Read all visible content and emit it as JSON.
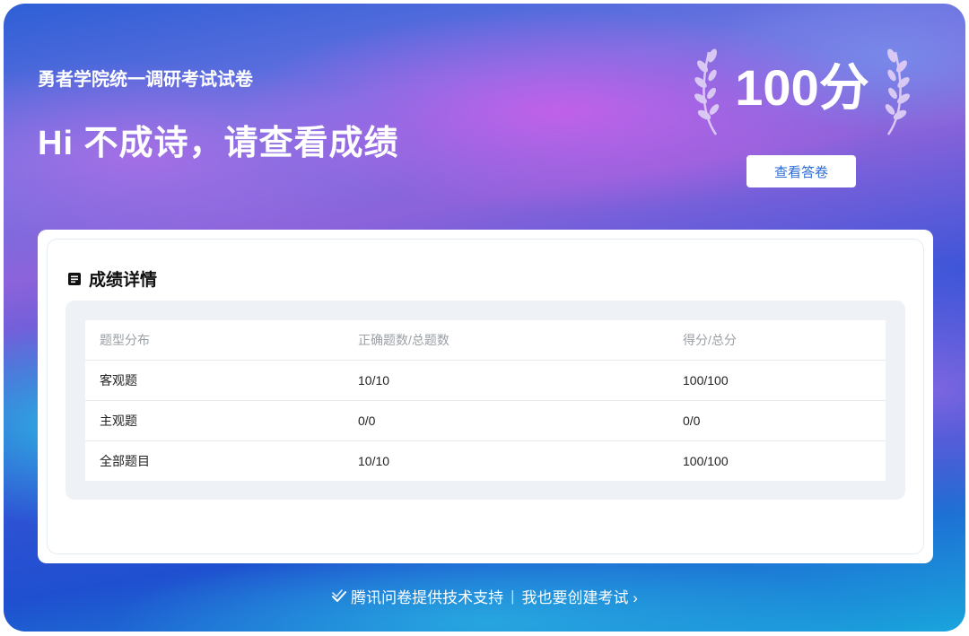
{
  "header": {
    "exam_title": "勇者学院统一调研考试试卷",
    "greeting": "Hi 不成诗，请查看成绩",
    "score": "100分",
    "view_answers_label": "查看答卷"
  },
  "details": {
    "title": "成绩详情",
    "icon": "document-list-icon",
    "columns": [
      "题型分布",
      "正确题数/总题数",
      "得分/总分"
    ],
    "rows": [
      [
        "客观题",
        "10/10",
        "100/100"
      ],
      [
        "主观题",
        "0/0",
        "0/0"
      ],
      [
        "全部题目",
        "10/10",
        "100/100"
      ]
    ]
  },
  "footer": {
    "support_text": "腾讯问卷提供技术支持",
    "divider": "|",
    "create_link": "我也要创建考试",
    "create_chevron": "›",
    "icon": "check-icon"
  },
  "colors": {
    "accent": "#2e6bd6",
    "white": "#ffffff"
  }
}
